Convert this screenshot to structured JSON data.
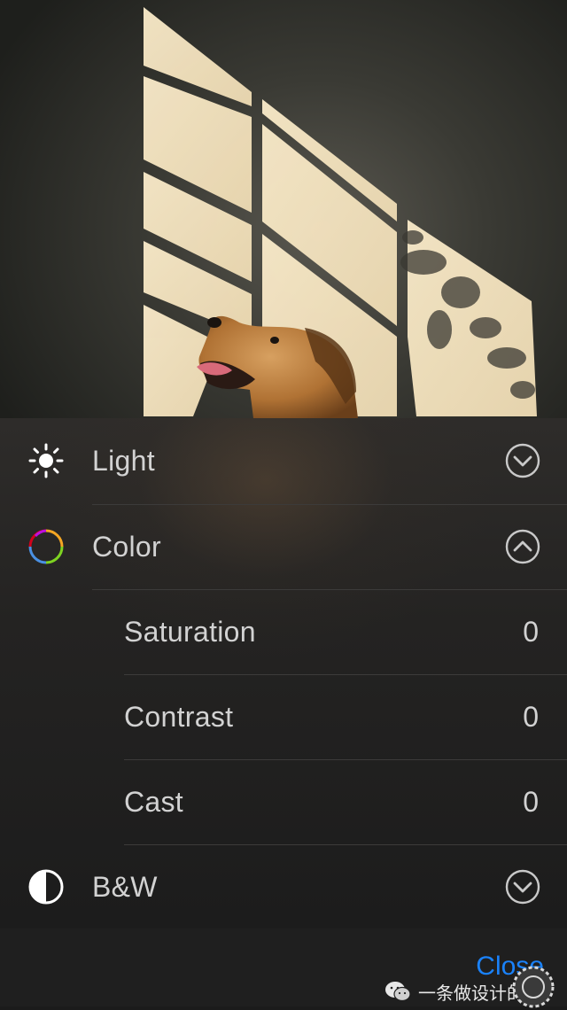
{
  "adjustments": {
    "light": {
      "label": "Light",
      "icon": "sun-icon",
      "state": "collapsed"
    },
    "color": {
      "label": "Color",
      "icon": "color-wheel-icon",
      "state": "expanded",
      "sub": [
        {
          "label": "Saturation",
          "value": "0"
        },
        {
          "label": "Contrast",
          "value": "0"
        },
        {
          "label": "Cast",
          "value": "0"
        }
      ]
    },
    "bw": {
      "label": "B&W",
      "icon": "half-circle-icon",
      "state": "collapsed"
    }
  },
  "bottom": {
    "close_label": "Close",
    "watermark_text": "一条做设计的狗"
  },
  "colors": {
    "accent": "#1a82fb",
    "text": "#d2d2d2",
    "panel": "#242322"
  }
}
